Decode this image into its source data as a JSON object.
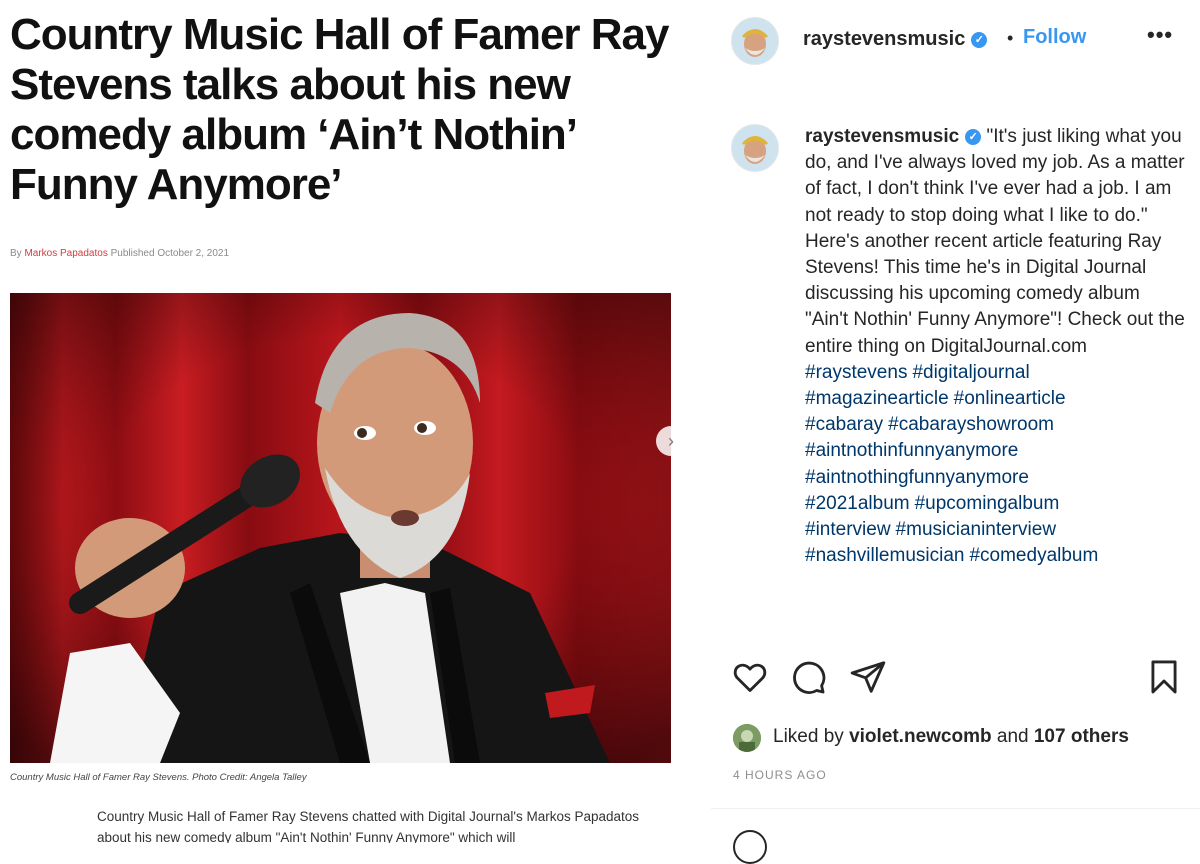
{
  "article": {
    "headline": "Country Music Hall of Famer Ray Stevens talks about his new comedy album ‘Ain’t Nothin’ Funny Anymore’",
    "byline_prefix": "By",
    "author": "Markos Papadatos",
    "published": "Published October 2, 2021",
    "photo_caption": "Country Music Hall of Famer Ray Stevens. Photo Credit: Angela Talley",
    "body": "Country Music Hall of Famer Ray Stevens chatted with Digital Journal's Markos Papadatos about his new comedy album \"Ain't Nothin' Funny Anymore\" which will"
  },
  "post": {
    "username": "raystevensmusic",
    "follow_label": "Follow",
    "more_label": "•••",
    "next_label": "›",
    "caption": "\"It's just liking what you do, and I've always loved my job. As a matter of fact, I don't think I've ever had a job. I am not ready to stop doing what I like to do.\" Here's another recent article featuring Ray Stevens! This time he's in Digital Journal discussing his upcoming comedy album \"Ain't Nothin' Funny Anymore\"! Check out the entire thing on DigitalJournal.com",
    "hashtags": [
      "#raystevens",
      "#digitaljournal",
      "#magazinearticle",
      "#onlinearticle",
      "#cabaray",
      "#cabarayshowroom",
      "#aintnothinfunnyanymore",
      "#aintnothingfunnyanymore",
      "#2021album",
      "#upcomingalbum",
      "#interview",
      "#musicianinterview",
      "#nashvillemusician",
      "#comedyalbum"
    ],
    "likes": {
      "prefix": "Liked by",
      "user": "violet.newcomb",
      "joiner": "and",
      "others": "107 others"
    },
    "timestamp": "4 HOURS AGO"
  },
  "icons": {
    "like": "heart-icon",
    "comment": "comment-icon",
    "share": "paper-plane-icon",
    "save": "bookmark-icon"
  },
  "colors": {
    "link_blue": "#3897f0",
    "hashtag": "#00376b",
    "verified": "#3897f0",
    "curtain": "#b3151b"
  }
}
